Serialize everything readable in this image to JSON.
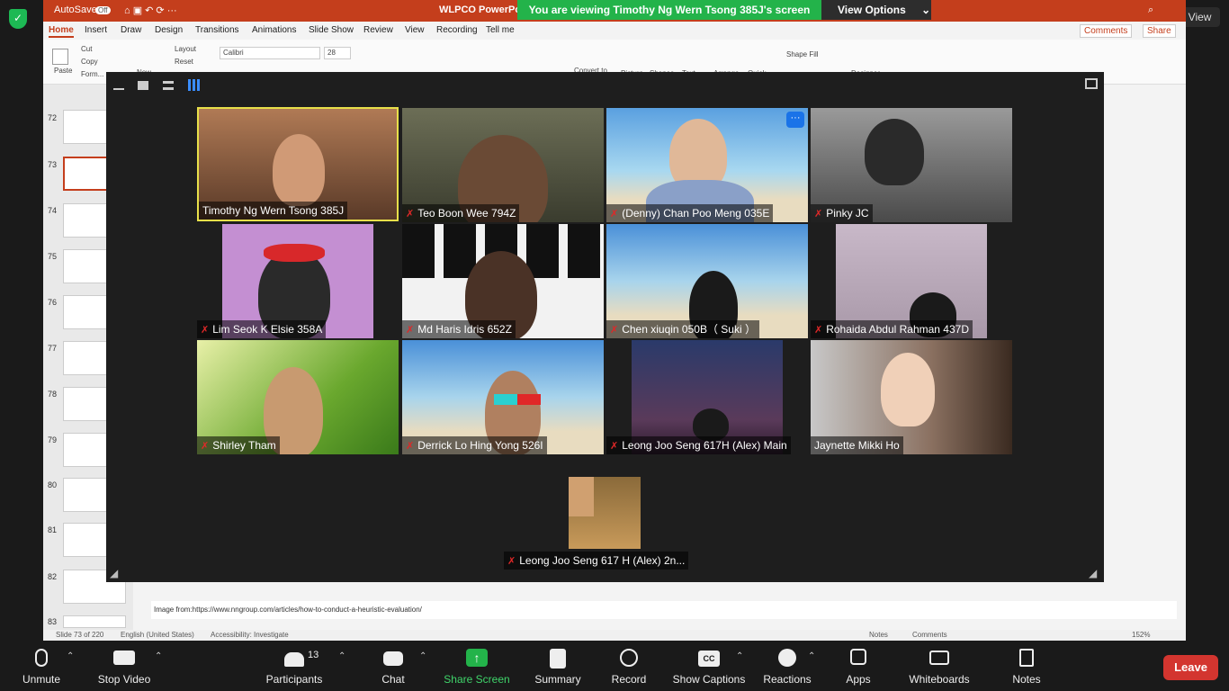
{
  "share_banner": {
    "text": "You are viewing Timothy Ng Wern Tsong 385J's screen",
    "view_options": "View Options"
  },
  "top_view_button": "View",
  "ppt": {
    "autosave": "AutoSave",
    "autosave_state": "Off",
    "doc_title": "WLPCO PowerPo...",
    "tabs": [
      "Home",
      "Insert",
      "Draw",
      "Design",
      "Transitions",
      "Animations",
      "Slide Show",
      "Review",
      "View",
      "Recording",
      "Tell me"
    ],
    "comments": "Comments",
    "share": "Share",
    "ribbon": {
      "paste": "Paste",
      "cut": "Cut",
      "copy": "Copy",
      "format": "Form...",
      "new": "New",
      "layout": "Layout",
      "reset": "Reset",
      "font": "Calibri",
      "size": "28",
      "convert": "Convert to",
      "picture": "Picture",
      "shapes": "Shapes",
      "text": "Text",
      "arrange": "Arrange",
      "quick": "Quick",
      "shape_fill": "Shape Fill",
      "shape_outline": "Shape Outline",
      "designer": "Designer"
    },
    "slide_numbers": [
      "72",
      "73",
      "74",
      "75",
      "76",
      "77",
      "78",
      "79",
      "80",
      "81",
      "82",
      "83"
    ],
    "notes_text": "Image from:https://www.nngroup.com/articles/how-to-conduct-a-heuristic-evaluation/",
    "status": {
      "slide": "Slide 73 of 220",
      "lang": "English (United States)",
      "access": "Accessibility: Investigate",
      "notes": "Notes",
      "comments": "Comments",
      "zoom": "152%"
    }
  },
  "participants": [
    {
      "name": "Timothy Ng Wern Tsong 385J",
      "muted": false
    },
    {
      "name": "Teo Boon Wee 794Z",
      "muted": true
    },
    {
      "name": "(Denny) Chan Poo Meng 035E",
      "muted": true
    },
    {
      "name": "Pinky JC",
      "muted": true
    },
    {
      "name": "Lim Seok K Elsie 358A",
      "muted": true
    },
    {
      "name": "Md Haris Idris 652Z",
      "muted": true
    },
    {
      "name": "Chen xiuqin 050B（ Suki ）",
      "muted": true
    },
    {
      "name": "Rohaida Abdul Rahman 437D",
      "muted": true
    },
    {
      "name": "Shirley Tham",
      "muted": true
    },
    {
      "name": "Derrick Lo Hing Yong 526I",
      "muted": true
    },
    {
      "name": "Leong Joo Seng 617H (Alex) Main",
      "muted": true
    },
    {
      "name": "Jaynette Mikki Ho",
      "muted": false
    },
    {
      "name": "Leong Joo Seng 617 H (Alex) 2n...",
      "muted": true
    }
  ],
  "toolbar": {
    "unmute": "Unmute",
    "stop_video": "Stop Video",
    "participants": "Participants",
    "participants_count": "13",
    "chat": "Chat",
    "share_screen": "Share Screen",
    "summary": "Summary",
    "record": "Record",
    "captions": "Show Captions",
    "reactions": "Reactions",
    "apps": "Apps",
    "whiteboards": "Whiteboards",
    "notes": "Notes",
    "leave": "Leave"
  },
  "colors": {
    "accent_green": "#23b34a",
    "ppt_red": "#c43e1c",
    "leave_red": "#d3352f",
    "active_speaker": "#e8e04a"
  }
}
